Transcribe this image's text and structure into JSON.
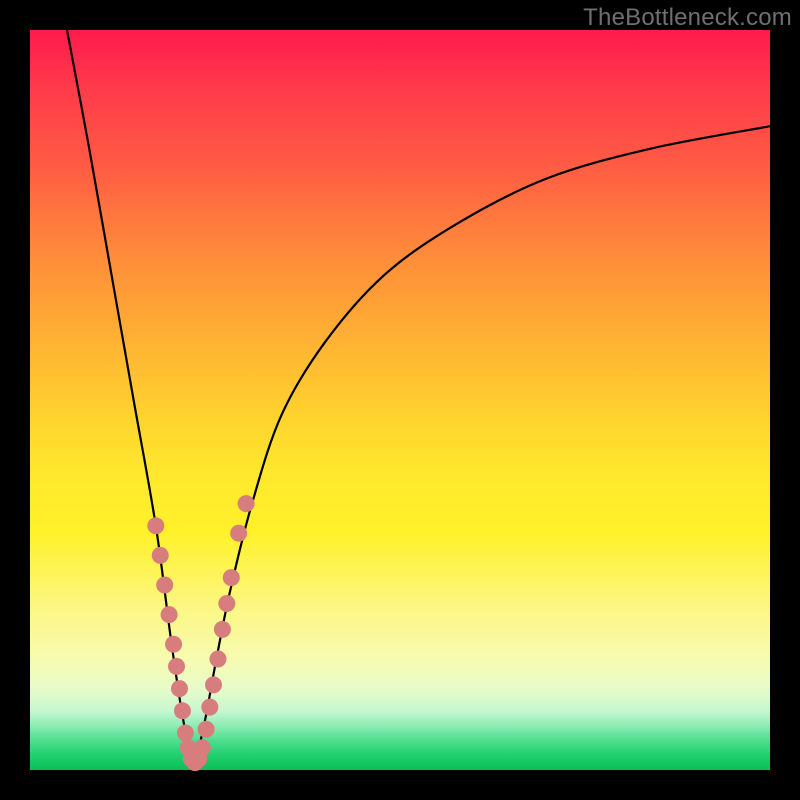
{
  "watermark": "TheBottleneck.com",
  "colors": {
    "background_frame": "#000000",
    "gradient_top": "#ff1a4d",
    "gradient_mid": "#ffd22e",
    "gradient_bottom": "#0ac057",
    "curve": "#000000",
    "markers": "#d77d7d"
  },
  "chart_data": {
    "type": "line",
    "title": "",
    "xlabel": "",
    "ylabel": "",
    "xlim": [
      0,
      100
    ],
    "ylim": [
      0,
      100
    ],
    "note": "No numeric axes or labels are visible. X/Y values below are estimated from pixel positions on a 0–100 grid (x: left→right, y: bottom→top). The plot depicts a V-shaped curve with minimum near x≈22, y≈0.",
    "series": [
      {
        "name": "bottleneck-curve",
        "x": [
          5,
          8,
          11,
          14,
          17,
          19,
          20.5,
          22,
          23.5,
          25,
          27,
          30,
          34,
          40,
          48,
          58,
          70,
          84,
          100
        ],
        "y": [
          100,
          84,
          67,
          50,
          33,
          18,
          8,
          1,
          6,
          14,
          24,
          36,
          48,
          58,
          67,
          74,
          80,
          84,
          87
        ]
      }
    ],
    "markers": {
      "name": "highlight-points",
      "note": "Pink circular markers clustered near the minimum of the curve.",
      "points": [
        {
          "x": 17.0,
          "y": 33
        },
        {
          "x": 17.6,
          "y": 29
        },
        {
          "x": 18.2,
          "y": 25
        },
        {
          "x": 18.8,
          "y": 21
        },
        {
          "x": 19.4,
          "y": 17
        },
        {
          "x": 19.8,
          "y": 14
        },
        {
          "x": 20.2,
          "y": 11
        },
        {
          "x": 20.6,
          "y": 8
        },
        {
          "x": 21.0,
          "y": 5
        },
        {
          "x": 21.4,
          "y": 3
        },
        {
          "x": 21.8,
          "y": 1.5
        },
        {
          "x": 22.3,
          "y": 1
        },
        {
          "x": 22.8,
          "y": 1.5
        },
        {
          "x": 23.3,
          "y": 3
        },
        {
          "x": 23.8,
          "y": 5.5
        },
        {
          "x": 24.3,
          "y": 8.5
        },
        {
          "x": 24.8,
          "y": 11.5
        },
        {
          "x": 25.4,
          "y": 15
        },
        {
          "x": 26.0,
          "y": 19
        },
        {
          "x": 26.6,
          "y": 22.5
        },
        {
          "x": 27.2,
          "y": 26
        },
        {
          "x": 28.2,
          "y": 32
        },
        {
          "x": 29.2,
          "y": 36
        }
      ]
    }
  }
}
